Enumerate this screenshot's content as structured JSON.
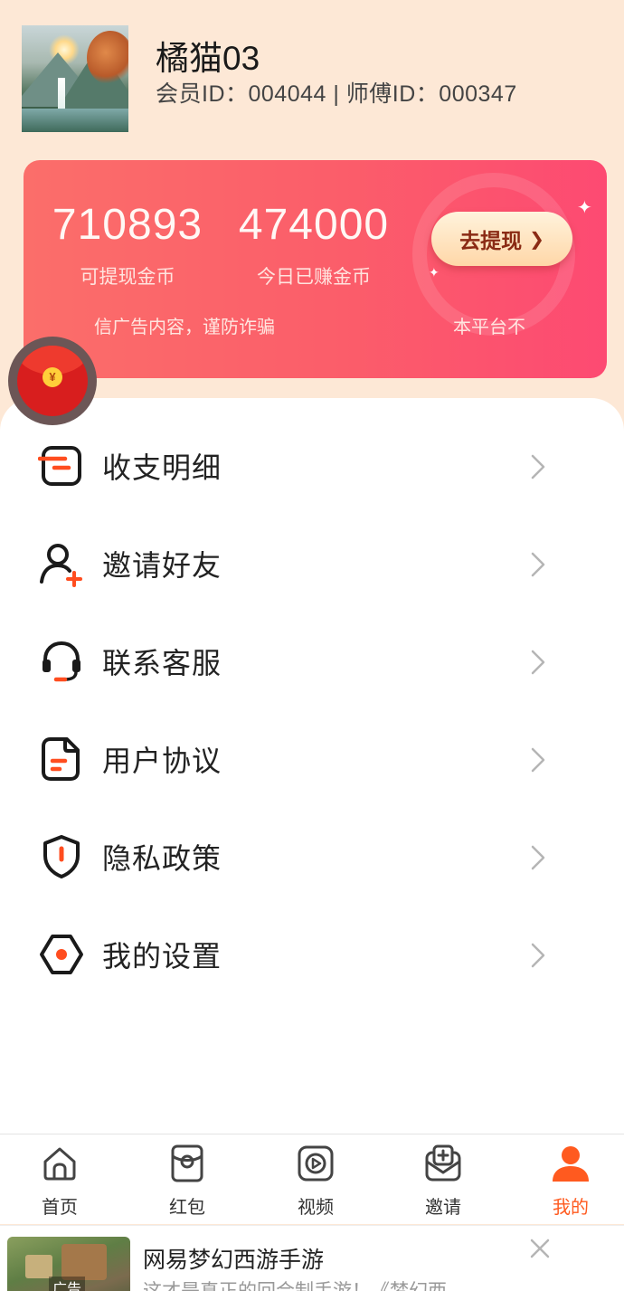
{
  "profile": {
    "username": "橘猫03",
    "ids": "会员ID：004044 | 师傅ID：000347"
  },
  "coins": {
    "withdrawable_value": "710893",
    "withdrawable_label": "可提现金币",
    "today_value": "474000",
    "today_label": "今日已赚金币",
    "withdraw_button": "去提现",
    "notice_left": "信广告内容，谨防诈骗",
    "notice_right": "本平台不"
  },
  "float_envelope": {
    "coin_symbol": "¥"
  },
  "menu": {
    "items": [
      {
        "label": "收支明细",
        "icon": "ledger-icon"
      },
      {
        "label": "邀请好友",
        "icon": "add-user-icon"
      },
      {
        "label": "联系客服",
        "icon": "headset-icon"
      },
      {
        "label": "用户协议",
        "icon": "document-icon"
      },
      {
        "label": "隐私政策",
        "icon": "shield-icon"
      },
      {
        "label": "我的设置",
        "icon": "settings-icon"
      }
    ]
  },
  "tabs": [
    {
      "label": "首页",
      "icon": "home-icon",
      "active": false
    },
    {
      "label": "红包",
      "icon": "red-packet-icon",
      "active": false
    },
    {
      "label": "视频",
      "icon": "video-icon",
      "active": false
    },
    {
      "label": "邀请",
      "icon": "invite-icon",
      "active": false
    },
    {
      "label": "我的",
      "icon": "user-icon",
      "active": true
    }
  ],
  "ad": {
    "title": "网易梦幻西游手游",
    "desc": "这才是真正的回合制手游！《梦幻西…",
    "tag": "广告"
  },
  "colors": {
    "accent": "#ff5a1f",
    "card_start": "#fb6e6a",
    "card_end": "#fd4a72",
    "page_bg": "#fde8d6"
  }
}
